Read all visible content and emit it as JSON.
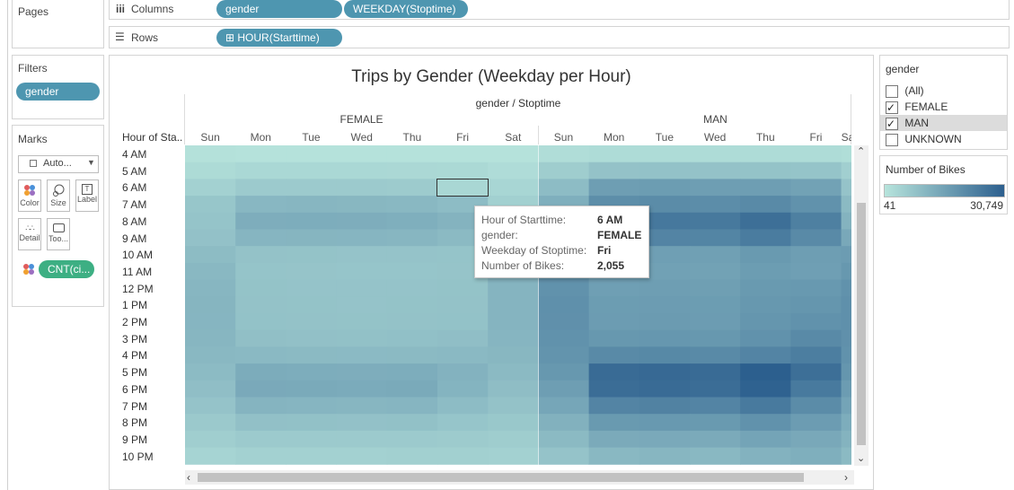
{
  "shelves": {
    "pages_label": "Pages",
    "columns_label": "Columns",
    "rows_label": "Rows",
    "column_pills": [
      "gender",
      "WEEKDAY(Stoptime)"
    ],
    "row_pill": "⊞ HOUR(Starttime)"
  },
  "filters": {
    "title": "Filters",
    "pill": "gender"
  },
  "marks": {
    "title": "Marks",
    "type_value": "Auto...",
    "buttons": [
      "Color",
      "Size",
      "Label",
      "Detail",
      "Too..."
    ],
    "pill": "CNT(ci..."
  },
  "view": {
    "title": "Trips by Gender (Weekday per Hour)",
    "header_title": "gender / Stoptime",
    "row_header": "Hour of Sta..",
    "gender_groups": [
      "FEMALE",
      "MAN"
    ],
    "weekdays_female": [
      "Sun",
      "Mon",
      "Tue",
      "Wed",
      "Thu",
      "Fri",
      "Sat"
    ],
    "weekdays_man": [
      "Sun",
      "Mon",
      "Tue",
      "Wed",
      "Thu",
      "Fri",
      "Sa"
    ],
    "hours": [
      "4 AM",
      "5 AM",
      "6 AM",
      "7 AM",
      "8 AM",
      "9 AM",
      "10 AM",
      "11 AM",
      "12 PM",
      "1 PM",
      "2 PM",
      "3 PM",
      "4 PM",
      "5 PM",
      "6 PM",
      "7 PM",
      "8 PM",
      "9 PM",
      "10 PM"
    ]
  },
  "tooltip": {
    "rows": [
      {
        "key": "Hour of Starttime:",
        "value": "6 AM"
      },
      {
        "key": "gender:",
        "value": "FEMALE"
      },
      {
        "key": "Weekday of Stoptime:",
        "value": "Fri"
      },
      {
        "key": "Number of Bikes:",
        "value": "2,055"
      }
    ]
  },
  "gender_filter": {
    "title": "gender",
    "items": [
      {
        "label": "(All)",
        "checked": false
      },
      {
        "label": "FEMALE",
        "checked": true
      },
      {
        "label": "MAN",
        "checked": true
      },
      {
        "label": "UNKNOWN",
        "checked": false
      }
    ]
  },
  "color_legend": {
    "title": "Number of Bikes",
    "min": "41",
    "max": "30,749",
    "color_low": "#b7e4dc",
    "color_high": "#2c5f8e"
  },
  "chart_data": {
    "type": "heatmap",
    "title": "Trips by Gender (Weekday per Hour)",
    "x_header": "gender / Stoptime",
    "y_label": "Hour of Sta..",
    "value_label": "Number of Bikes",
    "value_range": [
      41,
      30749
    ],
    "series": [
      {
        "name": "FEMALE",
        "columns": [
          "Sun",
          "Mon",
          "Tue",
          "Wed",
          "Thu",
          "Fri",
          "Sat"
        ],
        "values": [
          [
            400,
            300,
            300,
            300,
            300,
            300,
            300
          ],
          [
            1400,
            1900,
            1900,
            1900,
            1800,
            1700,
            1100
          ],
          [
            3200,
            4500,
            4600,
            4500,
            4300,
            2055,
            2200
          ],
          [
            5400,
            8600,
            8800,
            8700,
            8500,
            7500,
            3400
          ],
          [
            5800,
            10800,
            11000,
            10800,
            10500,
            9500,
            4500
          ],
          [
            6400,
            9000,
            9100,
            9000,
            8800,
            8000,
            5800
          ],
          [
            7600,
            6200,
            6100,
            6000,
            6000,
            5800,
            7500
          ],
          [
            8400,
            5800,
            5700,
            5600,
            5600,
            5700,
            8600
          ],
          [
            8900,
            6100,
            6000,
            5900,
            6000,
            6100,
            9200
          ],
          [
            9100,
            6200,
            6100,
            6000,
            6100,
            6200,
            9300
          ],
          [
            9000,
            6300,
            6200,
            6100,
            6200,
            6300,
            9200
          ],
          [
            8800,
            6800,
            6600,
            6500,
            6700,
            7000,
            9000
          ],
          [
            8400,
            8200,
            8000,
            7900,
            8000,
            8100,
            8700
          ],
          [
            7800,
            11200,
            11000,
            10800,
            11000,
            9800,
            8000
          ],
          [
            7000,
            11800,
            11600,
            11400,
            11700,
            9400,
            7200
          ],
          [
            6000,
            9200,
            9000,
            8800,
            9000,
            7500,
            6200
          ],
          [
            4800,
            6600,
            6500,
            6400,
            6500,
            5600,
            5000
          ],
          [
            3700,
            4600,
            4500,
            4500,
            4600,
            4300,
            4000
          ],
          [
            2600,
            3200,
            3200,
            3100,
            3300,
            3400,
            3200
          ]
        ]
      },
      {
        "name": "MAN",
        "columns": [
          "Sun",
          "Mon",
          "Tue",
          "Wed",
          "Thu",
          "Fri",
          "Sa"
        ],
        "values": [
          [
            1000,
            1200,
            1200,
            1200,
            1200,
            1200,
            900
          ],
          [
            4000,
            6200,
            6300,
            6200,
            6100,
            5800,
            3500
          ],
          [
            7500,
            14500,
            14800,
            14500,
            14400,
            13500,
            6000
          ],
          [
            10500,
            18500,
            19000,
            18800,
            19500,
            17500,
            8000
          ],
          [
            12000,
            23500,
            24000,
            23800,
            26500,
            22000,
            9500
          ],
          [
            13500,
            20500,
            21000,
            20800,
            23000,
            19500,
            12000
          ],
          [
            15500,
            14000,
            14200,
            14000,
            15500,
            14500,
            15000
          ],
          [
            16500,
            13500,
            13800,
            13600,
            14800,
            14200,
            16000
          ],
          [
            17500,
            14200,
            14500,
            14300,
            15500,
            15800,
            17500
          ],
          [
            18000,
            14800,
            15000,
            14800,
            16000,
            16500,
            18000
          ],
          [
            17800,
            15000,
            15200,
            15000,
            16500,
            17500,
            18000
          ],
          [
            17500,
            16000,
            16200,
            16000,
            17500,
            19500,
            17800
          ],
          [
            17000,
            19500,
            19800,
            19500,
            21000,
            22500,
            17500
          ],
          [
            16000,
            27500,
            28000,
            27500,
            30749,
            26500,
            16500
          ],
          [
            14500,
            27000,
            27500,
            27000,
            30000,
            23500,
            15000
          ],
          [
            12500,
            21000,
            21500,
            21000,
            23500,
            19000,
            13000
          ],
          [
            10000,
            15500,
            15800,
            15500,
            17500,
            15000,
            11000
          ],
          [
            8000,
            11500,
            11800,
            11500,
            13000,
            12000,
            9500
          ],
          [
            6000,
            8500,
            8800,
            8500,
            9800,
            10500,
            8000
          ]
        ]
      }
    ]
  }
}
